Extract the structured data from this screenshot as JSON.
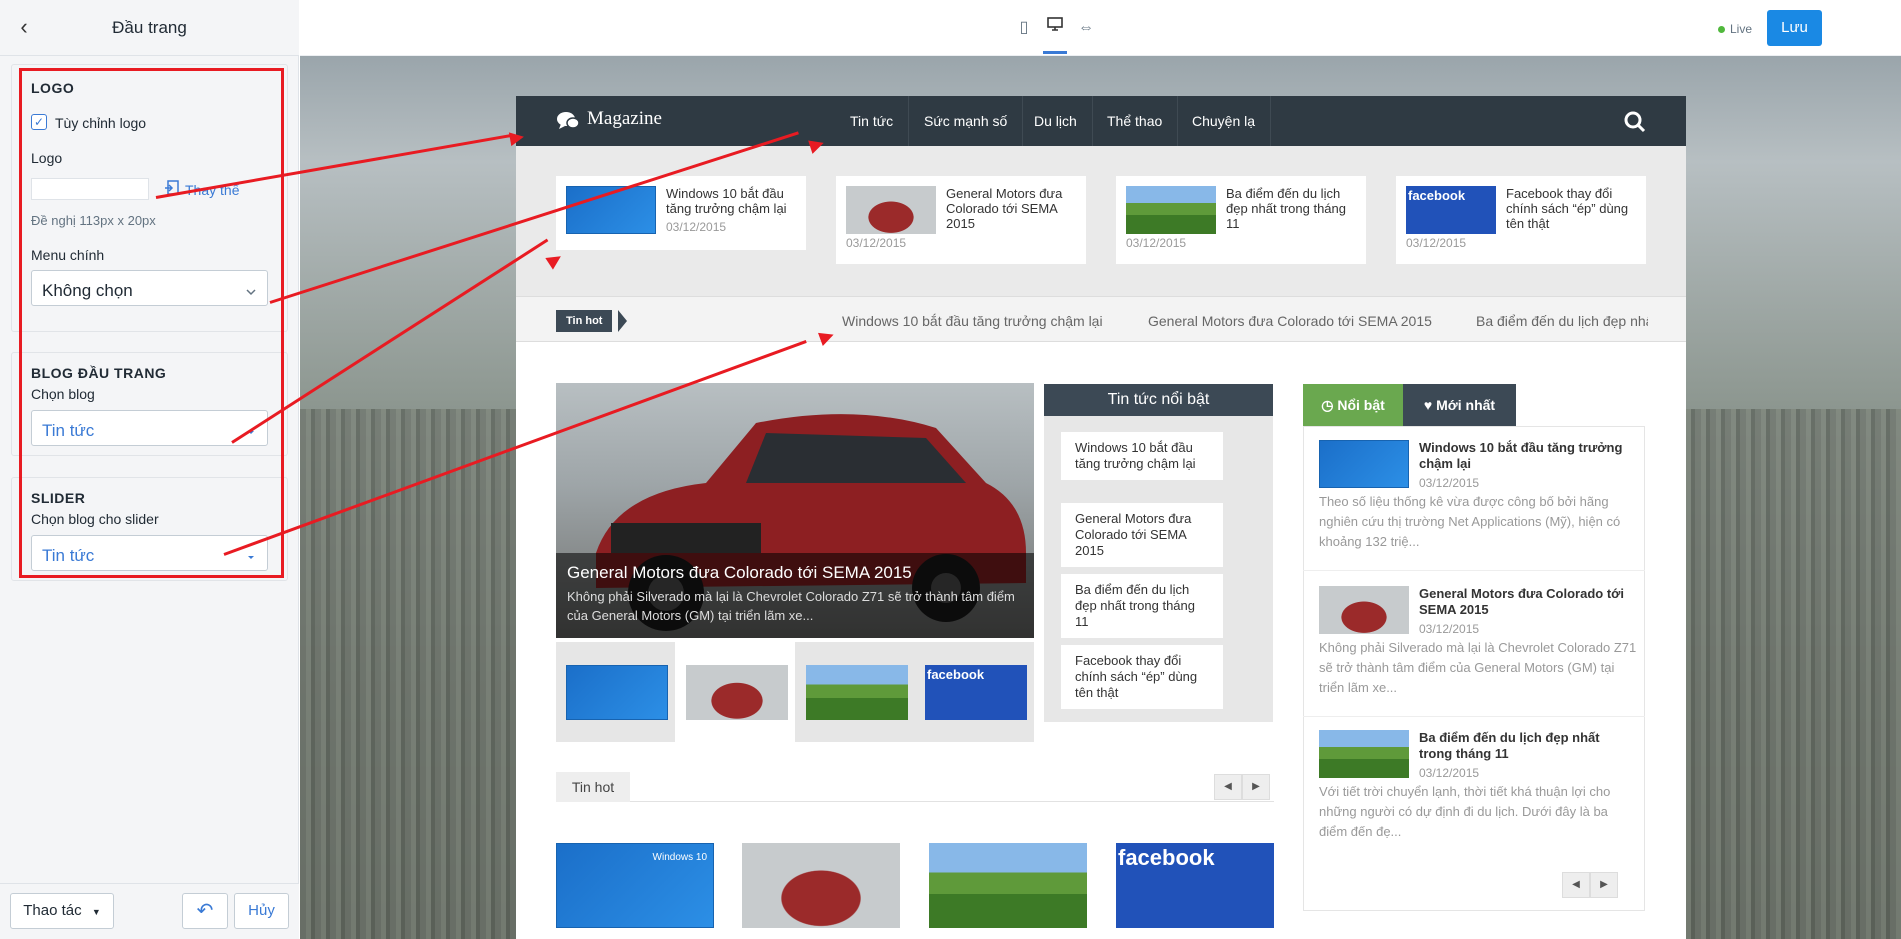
{
  "sidebar": {
    "title": "Đầu trang",
    "logo_section": {
      "title": "LOGO",
      "custom_logo_label": "Tùy chỉnh logo",
      "custom_logo_checked": true,
      "logo_label": "Logo",
      "replace_link": "Thay thế",
      "hint": "Đề nghị 113px x 20px",
      "menu_label": "Menu chính",
      "menu_value": "Không chọn"
    },
    "blog_section": {
      "title": "BLOG ĐẦU TRANG",
      "choose_label": "Chọn blog",
      "choose_value": "Tin tức"
    },
    "slider_section": {
      "title": "SLIDER",
      "choose_label": "Chọn blog cho slider",
      "choose_value": "Tin tức"
    },
    "footer": {
      "actions_label": "Thao tác",
      "cancel_label": "Hủy"
    }
  },
  "topbar": {
    "live_label": "Live",
    "save_label": "Lưu"
  },
  "site": {
    "logo_text": "Magazine",
    "nav": [
      "Tin tức",
      "Sức mạnh số",
      "Du lịch",
      "Thể thao",
      "Chuyện lạ"
    ],
    "news_cards": [
      {
        "title": "Windows 10 bắt đầu tăng trưởng chậm lại",
        "date": "03/12/2015",
        "img": "img-win"
      },
      {
        "title": "General Motors đưa Colorado tới SEMA 2015",
        "date": "03/12/2015",
        "img": "img-car"
      },
      {
        "title": "Ba điểm đến du lịch đẹp nhất trong tháng 11",
        "date": "03/12/2015",
        "img": "img-hill"
      },
      {
        "title": "Facebook thay đổi chính sách “ép” dùng tên thật",
        "date": "03/12/2015",
        "img": "img-fb"
      }
    ],
    "ticker_tag": "Tin hot",
    "ticker_items": [
      "Windows 10 bắt đầu tăng trưởng chậm lại",
      "General Motors đưa Colorado tới SEMA 2015",
      "Ba điểm đến du lịch đẹp nhấ"
    ],
    "hero": {
      "title": "General Motors đưa Colorado tới SEMA 2015",
      "desc": "Không phải Silverado mà lại là Chevrolet Colorado Z71 sẽ trở thành tâm điểm của General Motors (GM) tại triển lãm xe..."
    },
    "featured": {
      "title": "Tin tức nổi bật",
      "items": [
        "Windows 10 bắt đầu tăng trưởng chậm lại",
        "General Motors đưa Colorado tới SEMA 2015",
        "Ba điểm đến du lịch đẹp nhất trong tháng 11",
        "Facebook thay đổi chính sách “ép” dùng tên thật"
      ]
    },
    "tabs": {
      "popular": "Nổi bật",
      "latest": "Mới nhất"
    },
    "posts": [
      {
        "title": "Windows 10 bắt đầu tăng trưởng chậm lại",
        "date": "03/12/2015",
        "desc": "Theo số liệu thống kê vừa được công bố bởi hãng nghiên cứu thị trường Net Applications (Mỹ), hiện có khoảng 132 triệ..."
      },
      {
        "title": "General Motors đưa Colorado tới SEMA 2015",
        "date": "03/12/2015",
        "desc": "Không phải Silverado mà lại là Chevrolet Colorado Z71 sẽ trở thành tâm điểm của General Motors (GM) tại triển lãm xe..."
      },
      {
        "title": "Ba điểm đến du lịch đẹp nhất trong tháng 11",
        "date": "03/12/2015",
        "desc": "Với tiết trời chuyển lạnh, thời tiết khá thuận lợi cho những người có dự định đi du lịch. Dưới đây là ba điểm đến đẹ..."
      }
    ],
    "hot_label": "Tin hot",
    "win_badge": "Windows 10",
    "fb_badge": "facebook",
    "colors": {
      "nav": "#2f3a43",
      "tab_popular": "#6aa84f",
      "tab_latest": "#3c4955",
      "annotation": "#e81b22",
      "save": "#1a89e4"
    }
  }
}
